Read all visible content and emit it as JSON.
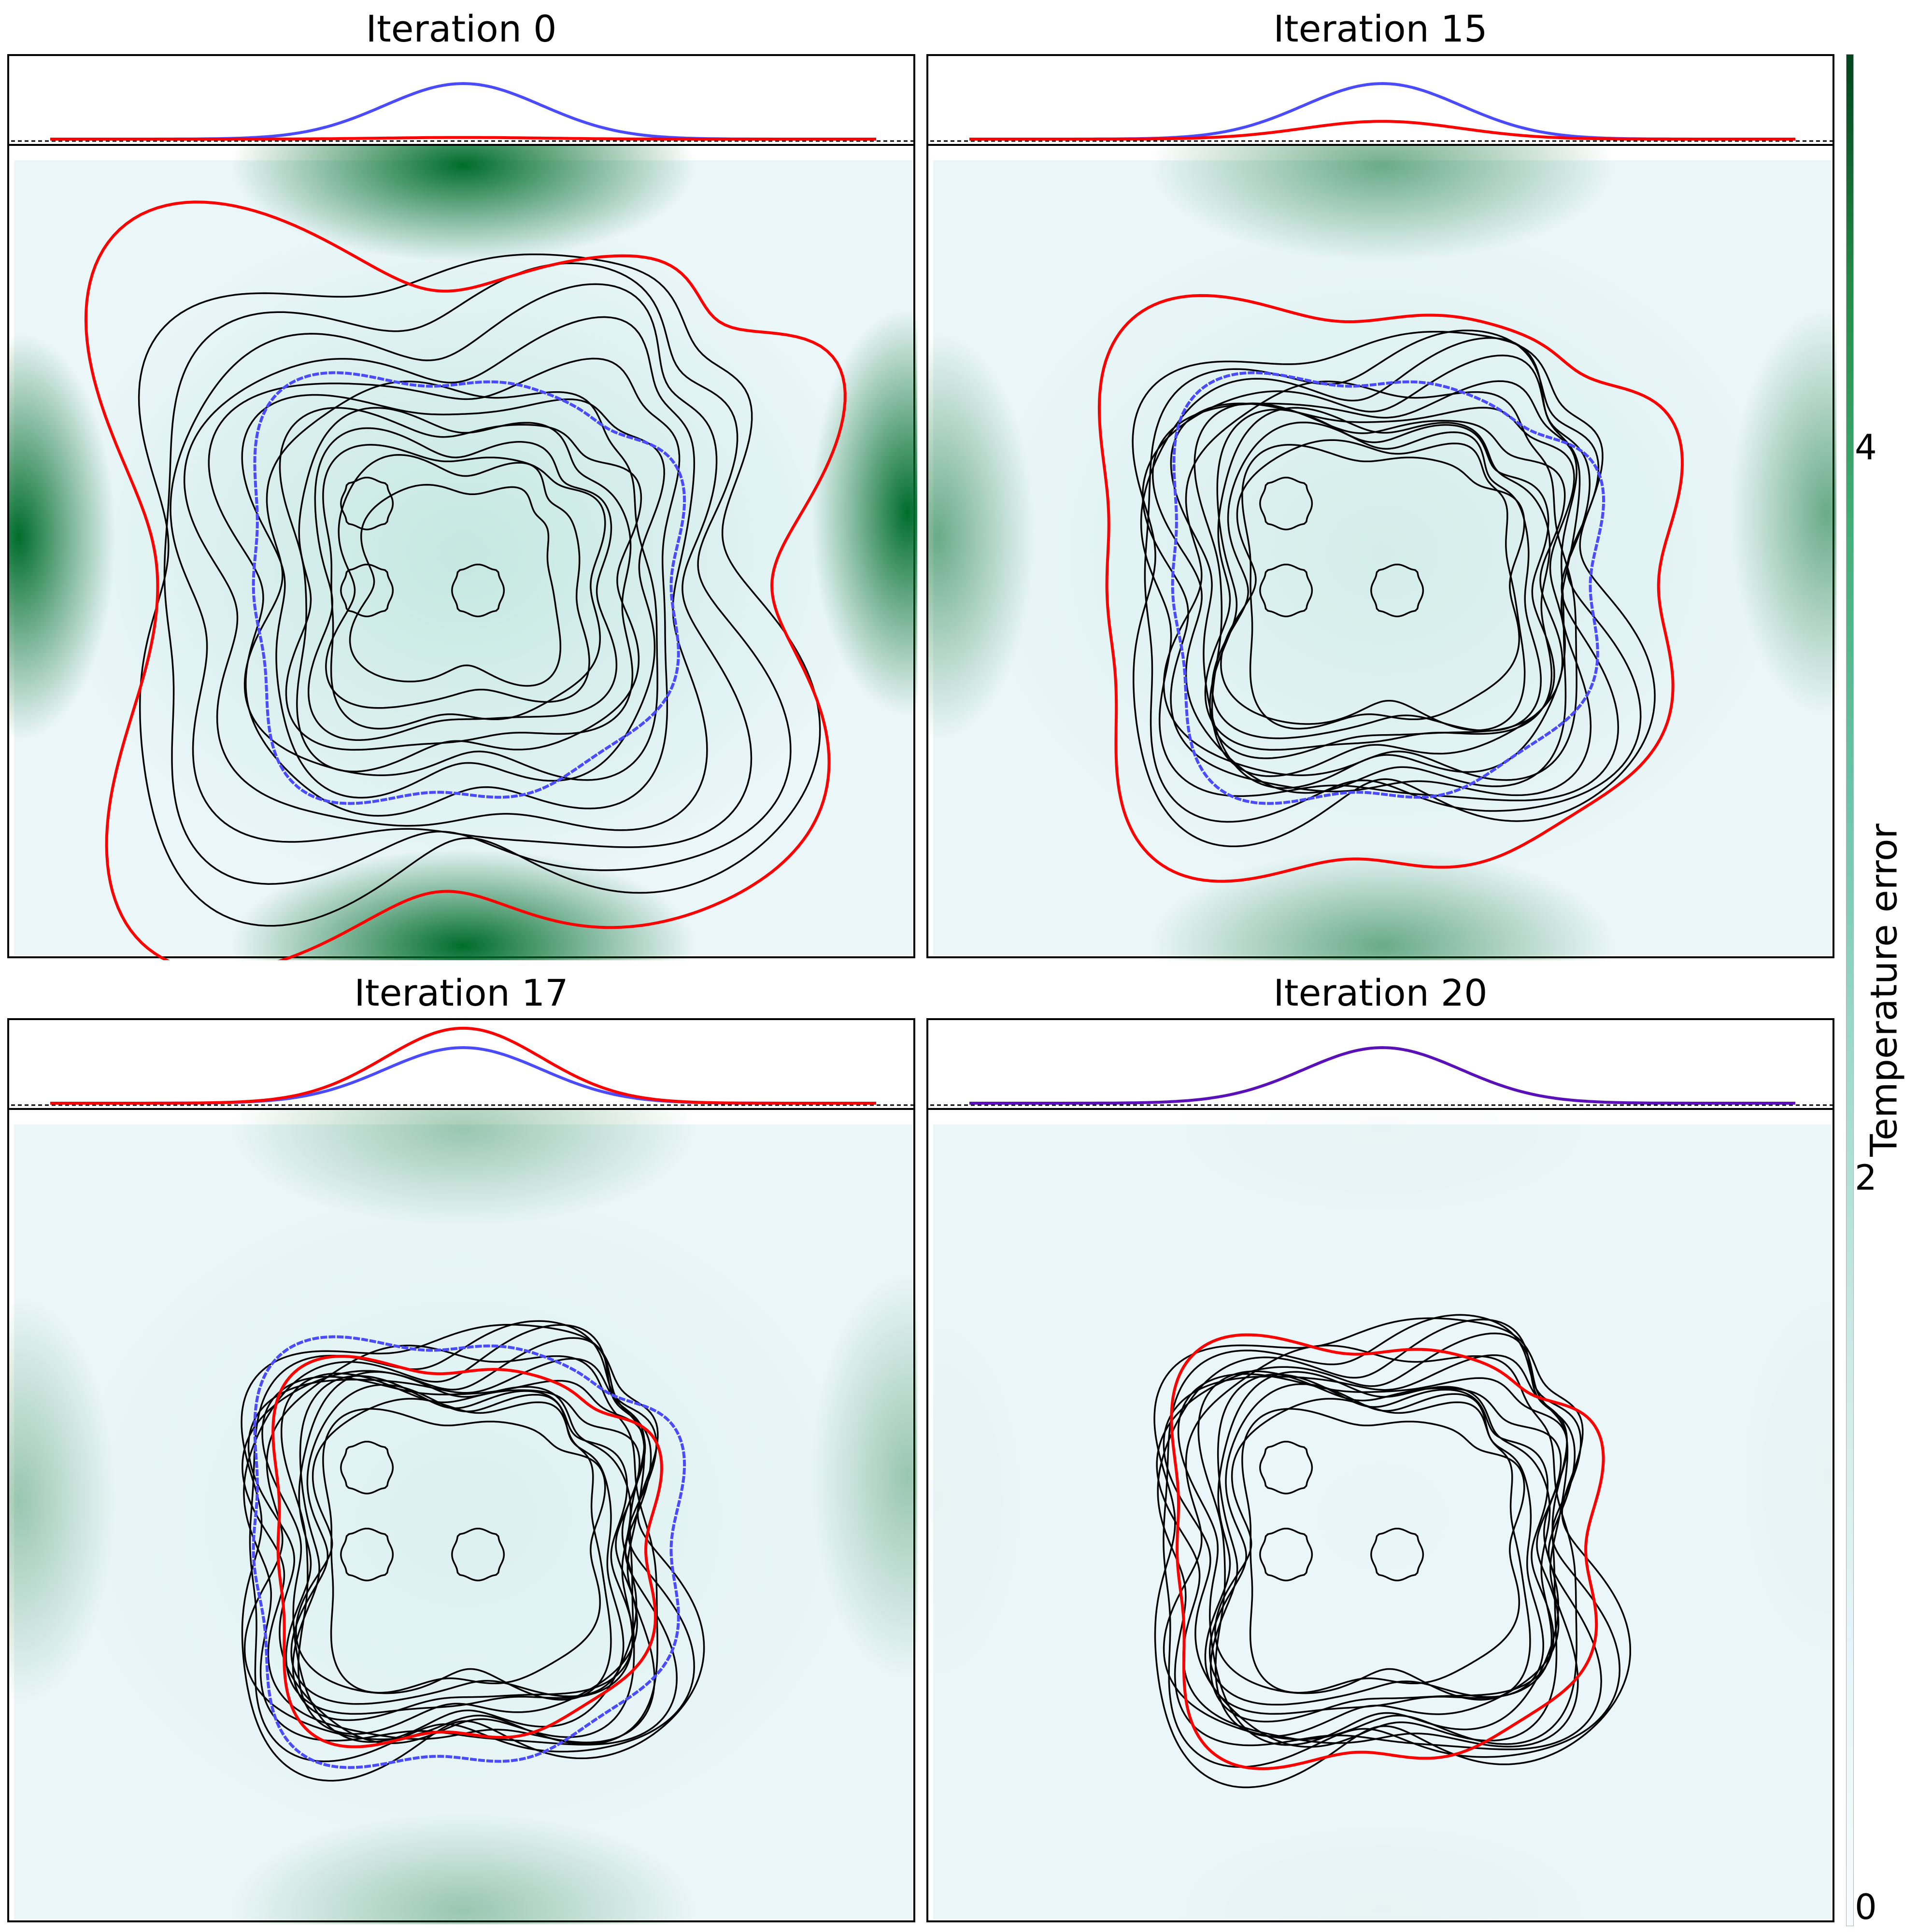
{
  "chart_data": [
    {
      "type": "heatmap",
      "title": "Iteration 0",
      "iteration": 0,
      "profile": {
        "reference_peak": 1.0,
        "current_peak": 0.03,
        "description_series": [
          "reference (blue)",
          "current (red)"
        ]
      },
      "shape_spread": 1.0,
      "error_level": 1.0,
      "red_scale": 1.78,
      "blue_scale": 1.0
    },
    {
      "type": "heatmap",
      "title": "Iteration 15",
      "iteration": 15,
      "profile": {
        "reference_peak": 1.0,
        "current_peak": 0.32
      },
      "shape_spread": 0.42,
      "error_level": 0.55,
      "red_scale": 1.35,
      "blue_scale": 1.0
    },
    {
      "type": "heatmap",
      "title": "Iteration 17",
      "iteration": 17,
      "profile": {
        "reference_peak": 1.0,
        "current_peak": 1.35
      },
      "shape_spread": 0.35,
      "error_level": 0.35,
      "red_scale": 0.9,
      "blue_scale": 1.0
    },
    {
      "type": "heatmap",
      "title": "Iteration 20",
      "iteration": 20,
      "profile": {
        "reference_peak": 1.0,
        "current_peak": 1.0
      },
      "shape_spread": 0.35,
      "error_level": 0.02,
      "red_scale": 1.0,
      "blue_scale": null
    }
  ],
  "colorbar": {
    "label": "Temperature error",
    "ticks": [
      "0",
      "2",
      "4"
    ],
    "range": [
      0,
      5.2
    ],
    "colormap": "BuGn"
  },
  "colors": {
    "reference": "#4a4aff",
    "current": "#ff0000",
    "contours": "#000000"
  }
}
